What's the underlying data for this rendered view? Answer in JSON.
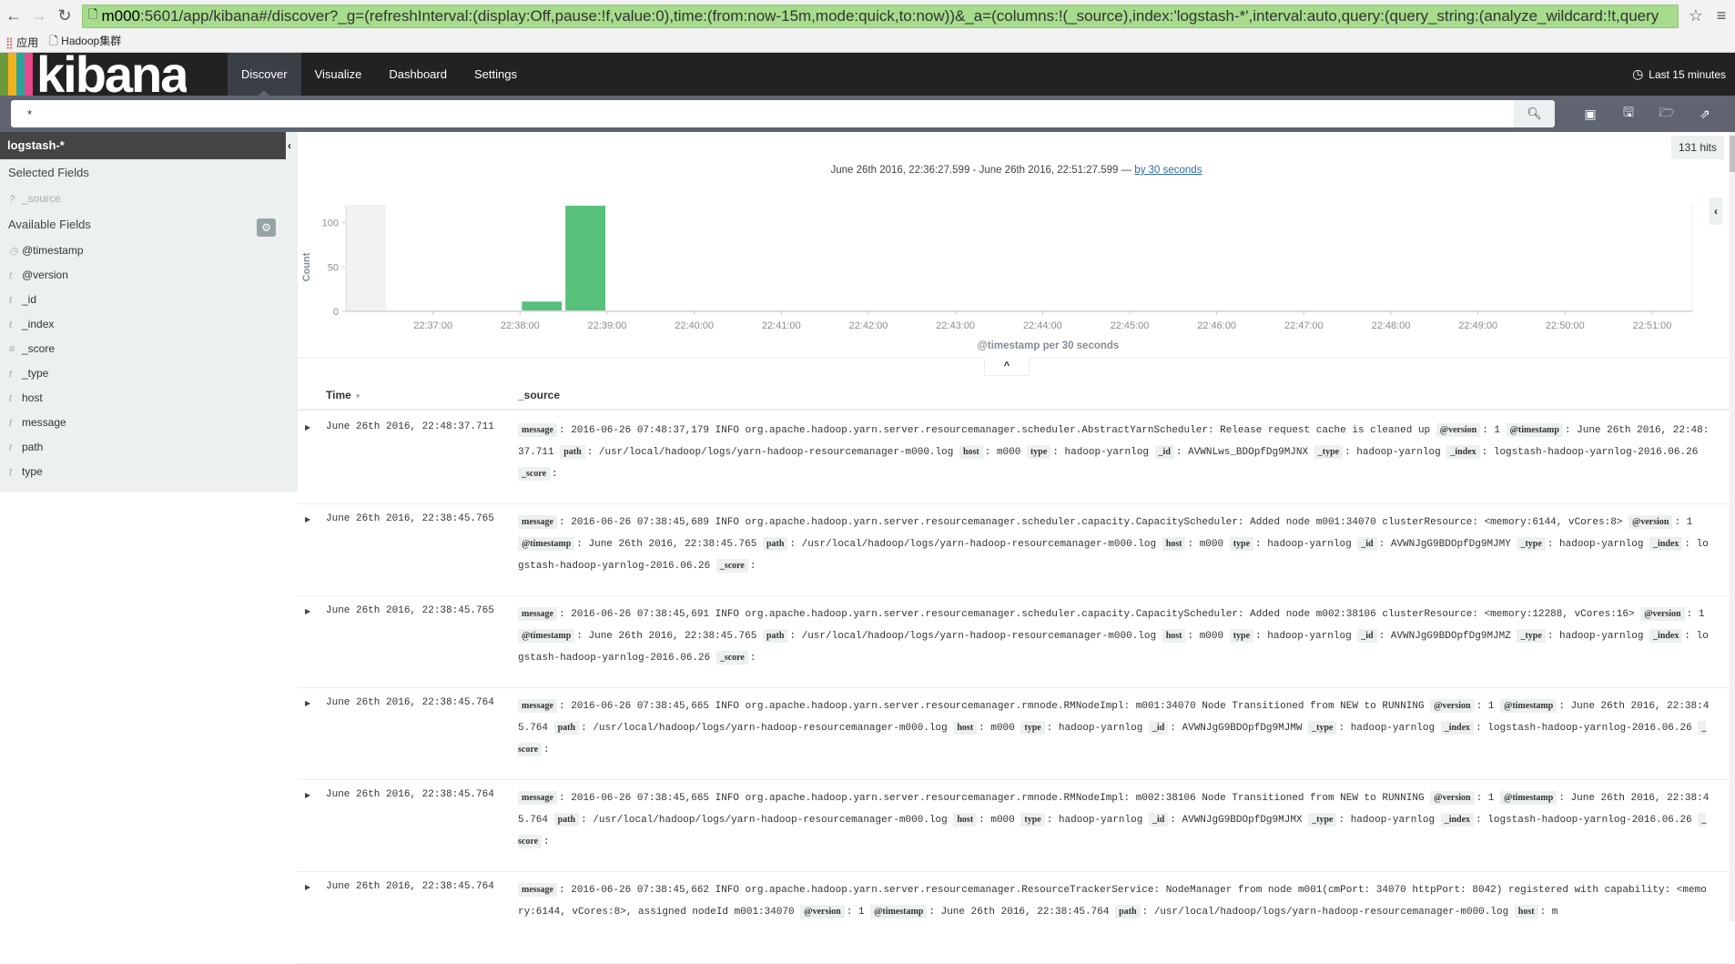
{
  "browser": {
    "url_host": "m000",
    "url_rest": ":5601/app/kibana#/discover?_g=(refreshInterval:(display:Off,pause:!f,value:0),time:(from:now-15m,mode:quick,to:now))&_a=(columns:!(_source),index:'logstash-*',interval:auto,query:(query_string:(analyze_wildcard:!t,query",
    "bookmarks": [
      "应用",
      "Hadoop集群"
    ]
  },
  "nav": {
    "logo": "kibana",
    "logo_colors": [
      "#6a9a3b",
      "#f3b21b",
      "#2aa59e",
      "#e8488a"
    ],
    "tabs": [
      "Discover",
      "Visualize",
      "Dashboard",
      "Settings"
    ],
    "active_tab": "Discover",
    "time_filter": "Last 15 minutes"
  },
  "search": {
    "query": "*"
  },
  "sidebar": {
    "index_pattern": "logstash-*",
    "selected_title": "Selected Fields",
    "selected_fields": [
      {
        "type": "?",
        "name": "_source"
      }
    ],
    "available_title": "Available Fields",
    "available_fields": [
      {
        "type": "clock",
        "name": "@timestamp"
      },
      {
        "type": "t",
        "name": "@version"
      },
      {
        "type": "t",
        "name": "_id"
      },
      {
        "type": "t",
        "name": "_index"
      },
      {
        "type": "#",
        "name": "_score"
      },
      {
        "type": "t",
        "name": "_type"
      },
      {
        "type": "t",
        "name": "host"
      },
      {
        "type": "t",
        "name": "message"
      },
      {
        "type": "t",
        "name": "path"
      },
      {
        "type": "t",
        "name": "type"
      }
    ]
  },
  "hits": "131 hits",
  "range": {
    "text": "June 26th 2016, 22:36:27.599 - June 26th 2016, 22:51:27.599 —",
    "interval_link": "by 30 seconds"
  },
  "chart_data": {
    "type": "bar",
    "xlabel": "@timestamp per 30 seconds",
    "ylabel": "Count",
    "x_range": [
      "22:36:00",
      "22:51:27.599"
    ],
    "out_of_range_until": "22:36:27.599",
    "ylim": [
      0,
      120
    ],
    "yticks": [
      0,
      50,
      100
    ],
    "xticks": [
      "22:37:00",
      "22:38:00",
      "22:39:00",
      "22:40:00",
      "22:41:00",
      "22:42:00",
      "22:43:00",
      "22:44:00",
      "22:45:00",
      "22:46:00",
      "22:47:00",
      "22:48:00",
      "22:49:00",
      "22:50:00",
      "22:51:00"
    ],
    "bucket_seconds": 30,
    "bars": [
      {
        "x": "22:38:00",
        "value": 11
      },
      {
        "x": "22:38:30",
        "value": 119
      },
      {
        "x": "22:48:30",
        "value": 1
      }
    ],
    "color": "#57c17b"
  },
  "table": {
    "headers": [
      "Time",
      "_source"
    ],
    "rows": [
      {
        "time": "June 26th 2016, 22:48:37.711",
        "source": [
          [
            "message",
            "2016-06-26 07:48:37,179 INFO org.apache.hadoop.yarn.server.resourcemanager.scheduler.AbstractYarnScheduler: Release request cache is cleaned up"
          ],
          [
            "@version",
            "1"
          ],
          [
            "@timestamp",
            "June 26th 2016, 22:48:37.711"
          ],
          [
            "path",
            "/usr/local/hadoop/logs/yarn-hadoop-resourcemanager-m000.log"
          ],
          [
            "host",
            "m000"
          ],
          [
            "type",
            "hadoop-yarnlog"
          ],
          [
            "_id",
            "AVWNLws_BDOpfDg9MJNX"
          ],
          [
            "_type",
            "hadoop-yarnlog"
          ],
          [
            "_index",
            "logstash-hadoop-yarnlog-2016.06.26"
          ],
          [
            "_score",
            ""
          ]
        ]
      },
      {
        "time": "June 26th 2016, 22:38:45.765",
        "source": [
          [
            "message",
            "2016-06-26 07:38:45,689 INFO org.apache.hadoop.yarn.server.resourcemanager.scheduler.capacity.CapacityScheduler: Added node m001:34070 clusterResource: <memory:6144, vCores:8>"
          ],
          [
            "@version",
            "1"
          ],
          [
            "@timestamp",
            "June 26th 2016, 22:38:45.765"
          ],
          [
            "path",
            "/usr/local/hadoop/logs/yarn-hadoop-resourcemanager-m000.log"
          ],
          [
            "host",
            "m000"
          ],
          [
            "type",
            "hadoop-yarnlog"
          ],
          [
            "_id",
            "AVWNJgG9BDOpfDg9MJMY"
          ],
          [
            "_type",
            "hadoop-yarnlog"
          ],
          [
            "_index",
            "logstash-hadoop-yarnlog-2016.06.26"
          ],
          [
            "_score",
            ""
          ]
        ]
      },
      {
        "time": "June 26th 2016, 22:38:45.765",
        "source": [
          [
            "message",
            "2016-06-26 07:38:45,691 INFO org.apache.hadoop.yarn.server.resourcemanager.scheduler.capacity.CapacityScheduler: Added node m002:38106 clusterResource: <memory:12288, vCores:16>"
          ],
          [
            "@version",
            "1"
          ],
          [
            "@timestamp",
            "June 26th 2016, 22:38:45.765"
          ],
          [
            "path",
            "/usr/local/hadoop/logs/yarn-hadoop-resourcemanager-m000.log"
          ],
          [
            "host",
            "m000"
          ],
          [
            "type",
            "hadoop-yarnlog"
          ],
          [
            "_id",
            "AVWNJgG9BDOpfDg9MJMZ"
          ],
          [
            "_type",
            "hadoop-yarnlog"
          ],
          [
            "_index",
            "logstash-hadoop-yarnlog-2016.06.26"
          ],
          [
            "_score",
            ""
          ]
        ]
      },
      {
        "time": "June 26th 2016, 22:38:45.764",
        "source": [
          [
            "message",
            "2016-06-26 07:38:45,665 INFO org.apache.hadoop.yarn.server.resourcemanager.rmnode.RMNodeImpl: m001:34070 Node Transitioned from NEW to RUNNING"
          ],
          [
            "@version",
            "1"
          ],
          [
            "@timestamp",
            "June 26th 2016, 22:38:45.764"
          ],
          [
            "path",
            "/usr/local/hadoop/logs/yarn-hadoop-resourcemanager-m000.log"
          ],
          [
            "host",
            "m000"
          ],
          [
            "type",
            "hadoop-yarnlog"
          ],
          [
            "_id",
            "AVWNJgG9BDOpfDg9MJMW"
          ],
          [
            "_type",
            "hadoop-yarnlog"
          ],
          [
            "_index",
            "logstash-hadoop-yarnlog-2016.06.26"
          ],
          [
            "_score",
            ""
          ]
        ]
      },
      {
        "time": "June 26th 2016, 22:38:45.764",
        "source": [
          [
            "message",
            "2016-06-26 07:38:45,665 INFO org.apache.hadoop.yarn.server.resourcemanager.rmnode.RMNodeImpl: m002:38106 Node Transitioned from NEW to RUNNING"
          ],
          [
            "@version",
            "1"
          ],
          [
            "@timestamp",
            "June 26th 2016, 22:38:45.764"
          ],
          [
            "path",
            "/usr/local/hadoop/logs/yarn-hadoop-resourcemanager-m000.log"
          ],
          [
            "host",
            "m000"
          ],
          [
            "type",
            "hadoop-yarnlog"
          ],
          [
            "_id",
            "AVWNJgG9BDOpfDg9MJMX"
          ],
          [
            "_type",
            "hadoop-yarnlog"
          ],
          [
            "_index",
            "logstash-hadoop-yarnlog-2016.06.26"
          ],
          [
            "_score",
            ""
          ]
        ]
      },
      {
        "time": "June 26th 2016, 22:38:45.764",
        "source": [
          [
            "message",
            "2016-06-26 07:38:45,662 INFO org.apache.hadoop.yarn.server.resourcemanager.ResourceTrackerService: NodeManager from node m001(cmPort: 34070 httpPort: 8042) registered with capability: <memory:6144, vCores:8>, assigned nodeId m001:34070"
          ],
          [
            "@version",
            "1"
          ],
          [
            "@timestamp",
            "June 26th 2016, 22:38:45.764"
          ],
          [
            "path",
            "/usr/local/hadoop/logs/yarn-hadoop-resourcemanager-m000.log"
          ],
          [
            "host",
            "m"
          ]
        ]
      }
    ]
  }
}
